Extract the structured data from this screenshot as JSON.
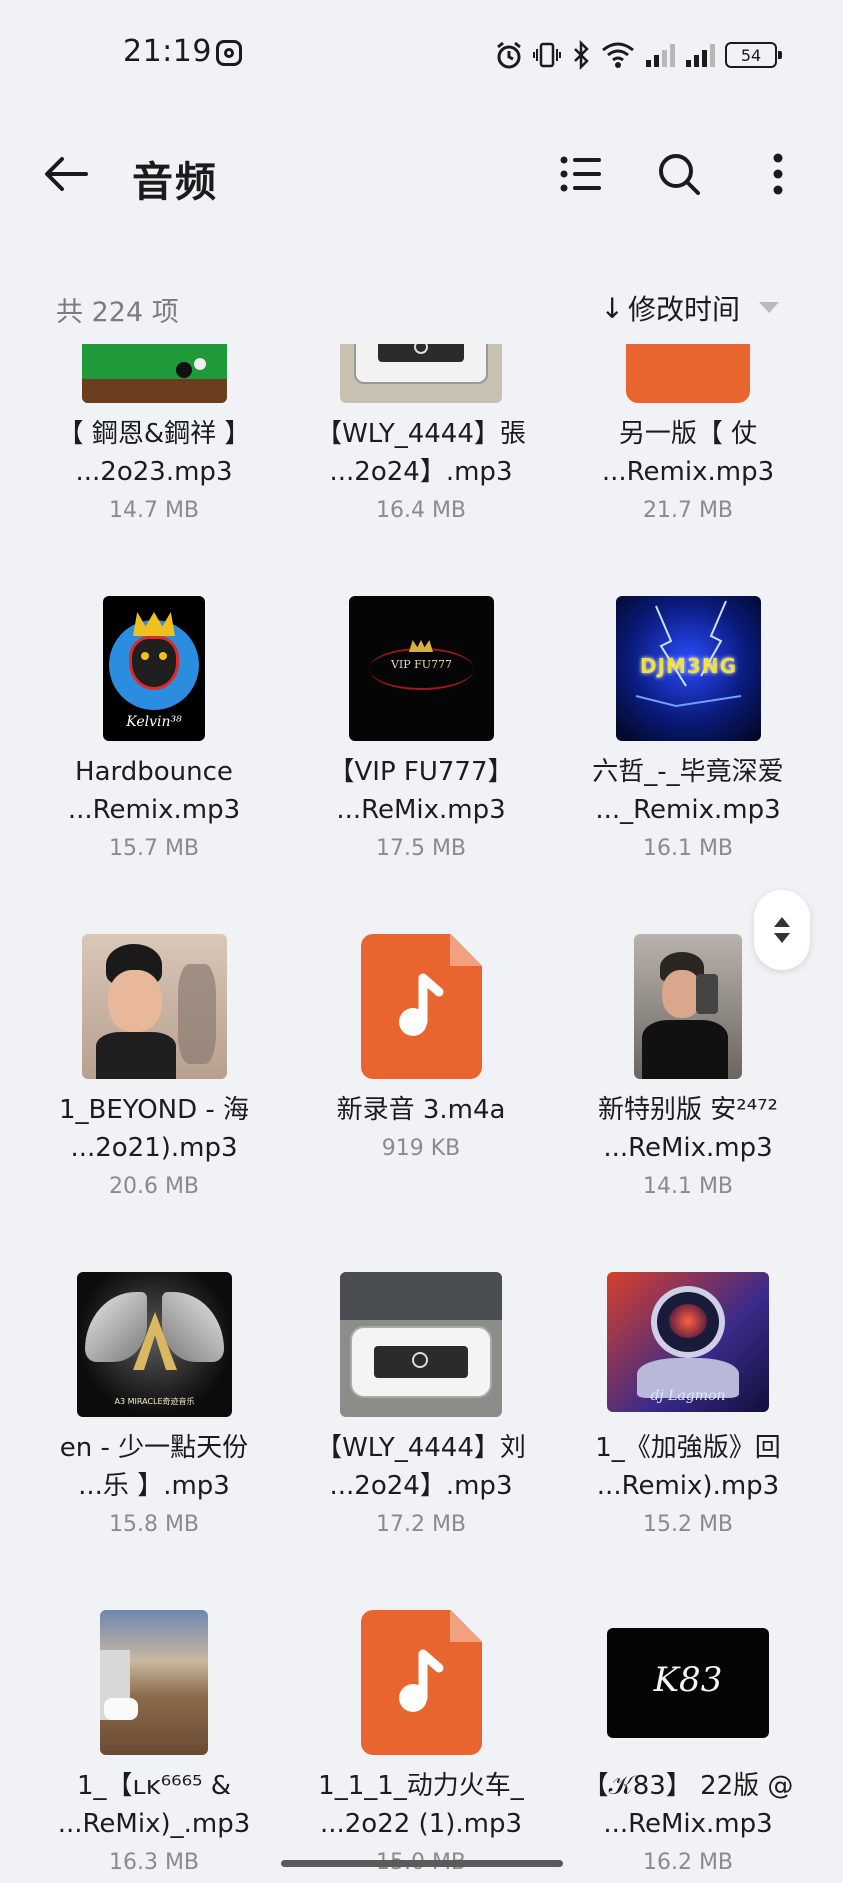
{
  "status_bar": {
    "time": "21:19",
    "battery": "54"
  },
  "app_bar": {
    "title": "音频"
  },
  "sort_bar": {
    "count": "共 224 项",
    "sort_label": "修改时间",
    "sort_arrow": "↓"
  },
  "files": [
    {
      "name1": "【 鋼恩&鋼祥 】",
      "name2": "...2o23.mp3",
      "size": "14.7 MB",
      "thumb": "billiards-table"
    },
    {
      "name1": "【WLY_4444】張",
      "name2": "...2o24】.mp3",
      "size": "16.4 MB",
      "thumb": "white-pickup-truck"
    },
    {
      "name1": "另一版【 仗",
      "name2": "...Remix.mp3",
      "size": "21.7 MB",
      "thumb": "audio-file-icon"
    },
    {
      "name1": "Hardbounce",
      "name2": "...Remix.mp3",
      "size": "15.7 MB",
      "thumb": "kelvin38-crown-logo",
      "thumb_text": "Kelvin³⁸"
    },
    {
      "name1": "【VIP FU777】",
      "name2": "...ReMix.mp3",
      "size": "17.5 MB",
      "thumb": "vip-fu777-logo",
      "thumb_text": "VIP FU777"
    },
    {
      "name1": "六哲_-_毕竟深爱",
      "name2": "..._Remix.mp3",
      "size": "16.1 MB",
      "thumb": "dj-m3ng-lightning",
      "thumb_text": "DJM3NG"
    },
    {
      "name1": "1_BEYOND - 海",
      "name2": "...2o21).mp3",
      "size": "20.6 MB",
      "thumb": "boy-selfie-photo"
    },
    {
      "name1": "新录音 3.m4a",
      "name2": "",
      "size": "919 KB",
      "thumb": "audio-file-icon"
    },
    {
      "name1": "新特别版 安²⁴⁷²",
      "name2": "...ReMix.mp3",
      "size": "14.1 MB",
      "thumb": "mirror-selfie-photo"
    },
    {
      "name1": "en - 少一點天份",
      "name2": "...乐 】.mp3",
      "size": "15.8 MB",
      "thumb": "a3-miracle-wings-logo",
      "thumb_text": "A3 MIRACLE奇迹音乐"
    },
    {
      "name1": "【WLY_4444】刘",
      "name2": "...2o24】.mp3",
      "size": "17.2 MB",
      "thumb": "white-pickup-truck"
    },
    {
      "name1": "1_《加強版》回",
      "name2": "...Remix).mp3",
      "size": "15.2 MB",
      "thumb": "dj-lagmon-astronaut",
      "thumb_text": "dj Lagmon"
    },
    {
      "name1": "1_【ʟᴋ⁶⁶⁶⁵ &",
      "name2": "...ReMix)_.mp3",
      "size": "16.3 MB",
      "thumb": "parking-sunset-photo"
    },
    {
      "name1": "1_1_1_动力火车_",
      "name2": "...2o22 (1).mp3",
      "size": "15.0 MB",
      "thumb": "audio-file-icon"
    },
    {
      "name1": "【𝒦83】 22版 @",
      "name2": "...ReMix.mp3",
      "size": "16.2 MB",
      "thumb": "k83-logo",
      "thumb_text": "K83"
    }
  ],
  "colors": {
    "accent_orange": "#e9652f",
    "background": "#f1f2f6"
  }
}
